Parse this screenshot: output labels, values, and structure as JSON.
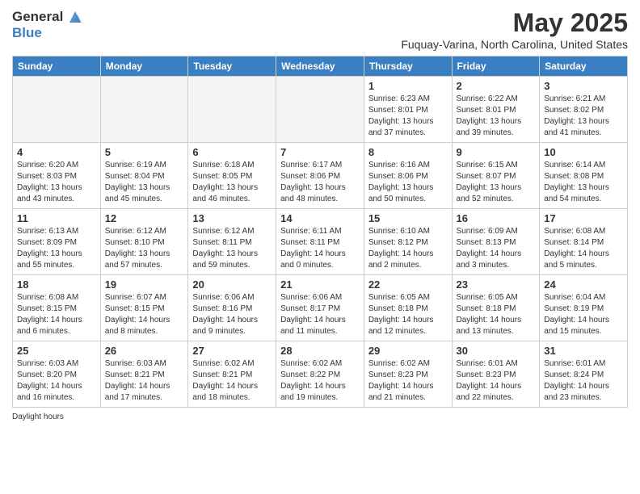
{
  "header": {
    "logo_line1": "General",
    "logo_line2": "Blue",
    "title": "May 2025",
    "subtitle": "Fuquay-Varina, North Carolina, United States"
  },
  "days_of_week": [
    "Sunday",
    "Monday",
    "Tuesday",
    "Wednesday",
    "Thursday",
    "Friday",
    "Saturday"
  ],
  "weeks": [
    [
      {
        "num": "",
        "info": "",
        "empty": true
      },
      {
        "num": "",
        "info": "",
        "empty": true
      },
      {
        "num": "",
        "info": "",
        "empty": true
      },
      {
        "num": "",
        "info": "",
        "empty": true
      },
      {
        "num": "1",
        "info": "Sunrise: 6:23 AM\nSunset: 8:01 PM\nDaylight: 13 hours\nand 37 minutes.",
        "empty": false
      },
      {
        "num": "2",
        "info": "Sunrise: 6:22 AM\nSunset: 8:01 PM\nDaylight: 13 hours\nand 39 minutes.",
        "empty": false
      },
      {
        "num": "3",
        "info": "Sunrise: 6:21 AM\nSunset: 8:02 PM\nDaylight: 13 hours\nand 41 minutes.",
        "empty": false
      }
    ],
    [
      {
        "num": "4",
        "info": "Sunrise: 6:20 AM\nSunset: 8:03 PM\nDaylight: 13 hours\nand 43 minutes.",
        "empty": false
      },
      {
        "num": "5",
        "info": "Sunrise: 6:19 AM\nSunset: 8:04 PM\nDaylight: 13 hours\nand 45 minutes.",
        "empty": false
      },
      {
        "num": "6",
        "info": "Sunrise: 6:18 AM\nSunset: 8:05 PM\nDaylight: 13 hours\nand 46 minutes.",
        "empty": false
      },
      {
        "num": "7",
        "info": "Sunrise: 6:17 AM\nSunset: 8:06 PM\nDaylight: 13 hours\nand 48 minutes.",
        "empty": false
      },
      {
        "num": "8",
        "info": "Sunrise: 6:16 AM\nSunset: 8:06 PM\nDaylight: 13 hours\nand 50 minutes.",
        "empty": false
      },
      {
        "num": "9",
        "info": "Sunrise: 6:15 AM\nSunset: 8:07 PM\nDaylight: 13 hours\nand 52 minutes.",
        "empty": false
      },
      {
        "num": "10",
        "info": "Sunrise: 6:14 AM\nSunset: 8:08 PM\nDaylight: 13 hours\nand 54 minutes.",
        "empty": false
      }
    ],
    [
      {
        "num": "11",
        "info": "Sunrise: 6:13 AM\nSunset: 8:09 PM\nDaylight: 13 hours\nand 55 minutes.",
        "empty": false
      },
      {
        "num": "12",
        "info": "Sunrise: 6:12 AM\nSunset: 8:10 PM\nDaylight: 13 hours\nand 57 minutes.",
        "empty": false
      },
      {
        "num": "13",
        "info": "Sunrise: 6:12 AM\nSunset: 8:11 PM\nDaylight: 13 hours\nand 59 minutes.",
        "empty": false
      },
      {
        "num": "14",
        "info": "Sunrise: 6:11 AM\nSunset: 8:11 PM\nDaylight: 14 hours\nand 0 minutes.",
        "empty": false
      },
      {
        "num": "15",
        "info": "Sunrise: 6:10 AM\nSunset: 8:12 PM\nDaylight: 14 hours\nand 2 minutes.",
        "empty": false
      },
      {
        "num": "16",
        "info": "Sunrise: 6:09 AM\nSunset: 8:13 PM\nDaylight: 14 hours\nand 3 minutes.",
        "empty": false
      },
      {
        "num": "17",
        "info": "Sunrise: 6:08 AM\nSunset: 8:14 PM\nDaylight: 14 hours\nand 5 minutes.",
        "empty": false
      }
    ],
    [
      {
        "num": "18",
        "info": "Sunrise: 6:08 AM\nSunset: 8:15 PM\nDaylight: 14 hours\nand 6 minutes.",
        "empty": false
      },
      {
        "num": "19",
        "info": "Sunrise: 6:07 AM\nSunset: 8:15 PM\nDaylight: 14 hours\nand 8 minutes.",
        "empty": false
      },
      {
        "num": "20",
        "info": "Sunrise: 6:06 AM\nSunset: 8:16 PM\nDaylight: 14 hours\nand 9 minutes.",
        "empty": false
      },
      {
        "num": "21",
        "info": "Sunrise: 6:06 AM\nSunset: 8:17 PM\nDaylight: 14 hours\nand 11 minutes.",
        "empty": false
      },
      {
        "num": "22",
        "info": "Sunrise: 6:05 AM\nSunset: 8:18 PM\nDaylight: 14 hours\nand 12 minutes.",
        "empty": false
      },
      {
        "num": "23",
        "info": "Sunrise: 6:05 AM\nSunset: 8:18 PM\nDaylight: 14 hours\nand 13 minutes.",
        "empty": false
      },
      {
        "num": "24",
        "info": "Sunrise: 6:04 AM\nSunset: 8:19 PM\nDaylight: 14 hours\nand 15 minutes.",
        "empty": false
      }
    ],
    [
      {
        "num": "25",
        "info": "Sunrise: 6:03 AM\nSunset: 8:20 PM\nDaylight: 14 hours\nand 16 minutes.",
        "empty": false
      },
      {
        "num": "26",
        "info": "Sunrise: 6:03 AM\nSunset: 8:21 PM\nDaylight: 14 hours\nand 17 minutes.",
        "empty": false
      },
      {
        "num": "27",
        "info": "Sunrise: 6:02 AM\nSunset: 8:21 PM\nDaylight: 14 hours\nand 18 minutes.",
        "empty": false
      },
      {
        "num": "28",
        "info": "Sunrise: 6:02 AM\nSunset: 8:22 PM\nDaylight: 14 hours\nand 19 minutes.",
        "empty": false
      },
      {
        "num": "29",
        "info": "Sunrise: 6:02 AM\nSunset: 8:23 PM\nDaylight: 14 hours\nand 21 minutes.",
        "empty": false
      },
      {
        "num": "30",
        "info": "Sunrise: 6:01 AM\nSunset: 8:23 PM\nDaylight: 14 hours\nand 22 minutes.",
        "empty": false
      },
      {
        "num": "31",
        "info": "Sunrise: 6:01 AM\nSunset: 8:24 PM\nDaylight: 14 hours\nand 23 minutes.",
        "empty": false
      }
    ]
  ],
  "footer": "Daylight hours"
}
